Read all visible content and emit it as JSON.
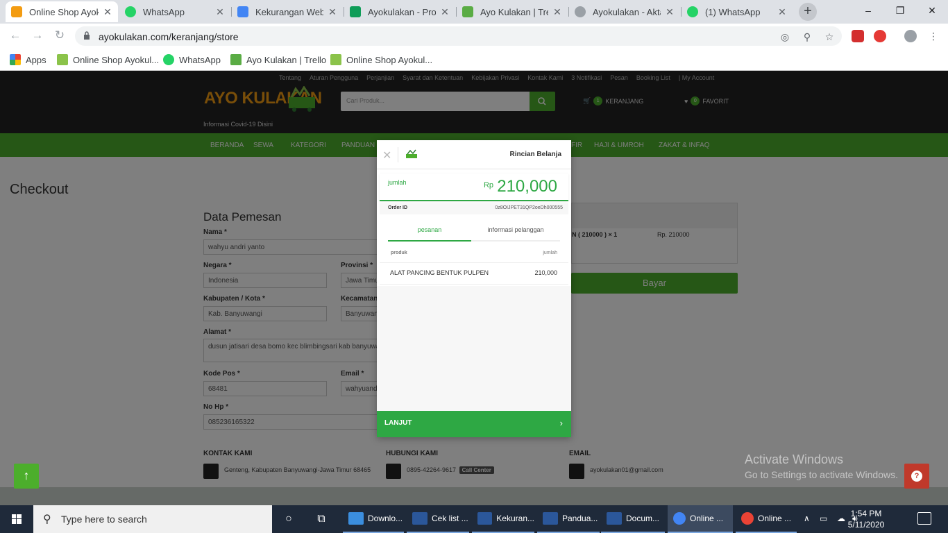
{
  "browser": {
    "tabs": [
      {
        "label": "Online Shop Ayok",
        "active": true,
        "icon_color": "#f39c12"
      },
      {
        "label": "WhatsApp",
        "active": false,
        "icon_color": "#25d366"
      },
      {
        "label": "Kekurangan Web /",
        "active": false,
        "icon_color": "#4285f4"
      },
      {
        "label": "Ayokulakan - Prog",
        "active": false,
        "icon_color": "#0f9d58"
      },
      {
        "label": "Ayo Kulakan | Trel",
        "active": false,
        "icon_color": "#5aac44"
      },
      {
        "label": "Ayokulakan - Akta",
        "active": false,
        "icon_color": "#9aa0a6"
      },
      {
        "label": "(1) WhatsApp",
        "active": false,
        "icon_color": "#25d366"
      }
    ],
    "new_tab": "+",
    "url": "ayokulakan.com/keranjang/store",
    "bookmarks": [
      {
        "label": "Apps"
      },
      {
        "label": "Online Shop Ayokul..."
      },
      {
        "label": "WhatsApp"
      },
      {
        "label": "Ayo Kulakan | Trello"
      },
      {
        "label": "Online Shop Ayokul..."
      }
    ]
  },
  "site": {
    "top_links": [
      "Tentang",
      "Aturan Pengguna",
      "Perjanjian",
      "Syarat dan Ketentuan",
      "Kebijakan Privasi",
      "Kontak Kami",
      "3 Notifikasi",
      "Pesan",
      "Booking List",
      "| My Account"
    ],
    "logo": "AYO KULAKAN",
    "covid": "Informasi Covid-19 Disini",
    "search_placeholder": "Cari Produk...",
    "cart_label": "KERANJANG",
    "cart_count": "1",
    "fav_label": "FAVORIT",
    "fav_count": "0",
    "nav": [
      "BERANDA",
      "SEWA",
      "KATEGORI",
      "PANDUAN",
      "FIR",
      "HAJI & UMROH",
      "ZAKAT & INFAQ"
    ],
    "accent": "#4cae2c"
  },
  "checkout": {
    "title": "Checkout",
    "form_title": "Data Pemesan",
    "nama_label": "Nama *",
    "nama_value": "wahyu andri yanto",
    "negara_label": "Negara *",
    "negara_value": "Indonesia",
    "provinsi_label": "Provinsi *",
    "provinsi_value": "Jawa Timur",
    "kota_label": "Kabupaten / Kota *",
    "kota_value": "Kab. Banyuwangi",
    "kecamatan_label": "Kecamatan",
    "kecamatan_value": "Banyuwangi",
    "alamat_label": "Alamat *",
    "alamat_value": "dusun jatisari desa bomo kec blimbingsari kab banyuwangi",
    "kodepos_label": "Kode Pos *",
    "kodepos_value": "68481",
    "email_label": "Email *",
    "email_value": "wahyuandri",
    "nohp_label": "No Hp *",
    "nohp_value": "085236165322",
    "summary_item": "N ( 210000 ) × 1",
    "summary_price": "Rp. 210000",
    "pay_button": "Bayar"
  },
  "footer": {
    "kontak_title": "KONTAK KAMI",
    "kontak_text": "Genteng, Kabupaten Banyuwangi-Jawa Timur 68465",
    "hubungi_title": "HUBUNGI KAMI",
    "hubungi_text": "0895-42264-9617",
    "call_center": "Call Center",
    "email_title": "EMAIL",
    "email_text": "ayokulakan01@gmail.com"
  },
  "modal": {
    "title": "Rincian Belanja",
    "amount_label": "jumlah",
    "currency": "Rp",
    "amount": "210,000",
    "order_id_label": "Order ID",
    "order_id": "0z8OIJPET31QP2oeDh000555",
    "tab_orders": "pesanan",
    "tab_customer": "informasi pelanggan",
    "col_product": "produk",
    "col_amount": "jumlah",
    "item_name": "ALAT PANCING BENTUK PULPEN",
    "item_amount": "210,000",
    "continue": "LANJUT",
    "accent": "#2ea844"
  },
  "watermark": {
    "line1": "Activate Windows",
    "line2": "Go to Settings to activate Windows."
  },
  "taskbar": {
    "search_placeholder": "Type here to search",
    "apps": [
      {
        "label": "Downlo...",
        "icon_color": "#3b8ede"
      },
      {
        "label": "Cek list ...",
        "icon_color": "#2b579a"
      },
      {
        "label": "Kekuran...",
        "icon_color": "#2b579a"
      },
      {
        "label": "Pandua...",
        "icon_color": "#2b579a"
      },
      {
        "label": "Docum...",
        "icon_color": "#2b579a"
      },
      {
        "label": "Online ...",
        "icon_color": "#4285f4"
      },
      {
        "label": "Online ...",
        "icon_color": "#4285f4"
      }
    ],
    "time": "1:54 PM",
    "date": "5/11/2020"
  }
}
